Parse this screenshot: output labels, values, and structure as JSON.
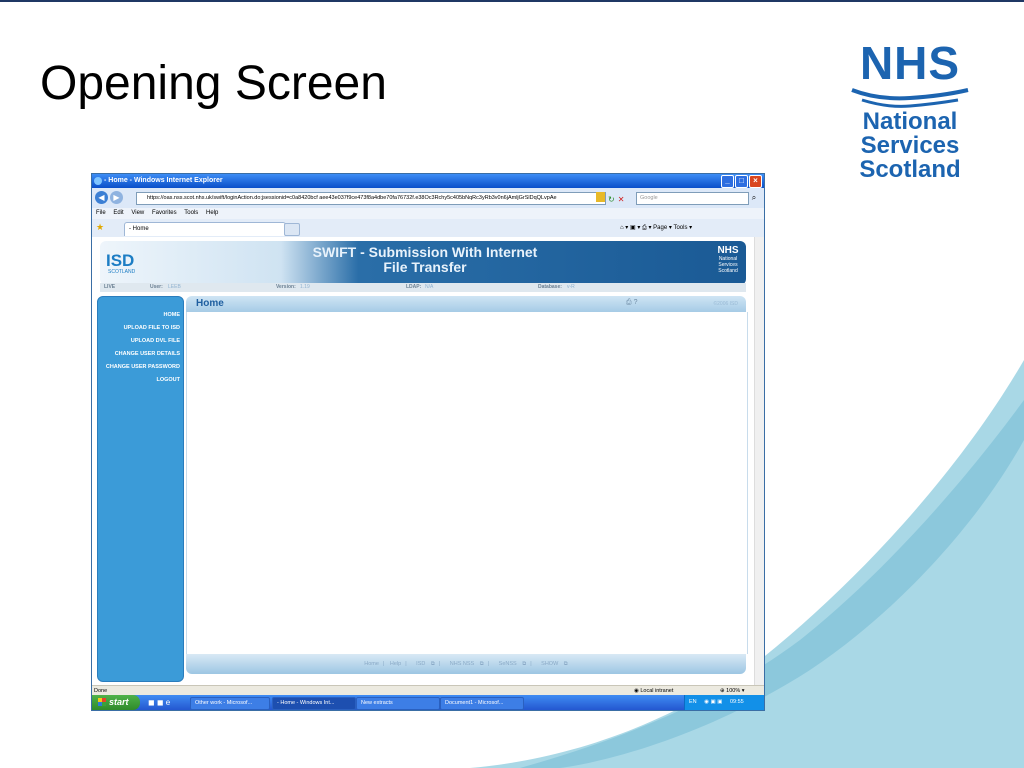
{
  "slide": {
    "title": "Opening Screen",
    "logo": {
      "primary": "NHS",
      "line1": "National",
      "line2": "Services",
      "line3": "Scotland"
    }
  },
  "browser": {
    "window_title": "- Home - Windows Internet Explorer",
    "url": "https://oas.nss.scot.nhs.uk/swift/loginAction.do;jsessionid=c0a8420bcf aee43e037f9ce473f8a4dbe70fa76732f.e38Oc3Rchy5c405bNqRc3yRb3v0n6jAmljGrSlDqQLvpAe",
    "search_placeholder": "Google",
    "menu": [
      "File",
      "Edit",
      "View",
      "Favorites",
      "Tools",
      "Help"
    ],
    "tab_title": "- Home",
    "toolbar": {
      "page": "Page",
      "tools": "Tools"
    },
    "status_text": "Done",
    "zone": "Local intranet",
    "zoom": "100%"
  },
  "swift": {
    "title_line1": "SWIFT - Submission With Internet",
    "title_line2": "File Transfer",
    "isd_logo": "ISD",
    "isd_sub": "SCOTLAND",
    "nhs_logo": "NHS",
    "nhs_sub1": "National",
    "nhs_sub2": "Services",
    "nhs_sub3": "Scotland",
    "info": {
      "live": "LIVE",
      "user_label": "User:",
      "user_value": "LEEB",
      "version_label": "Version:",
      "version_value": "1.19",
      "ldap_label": "LDAP:",
      "ldap_value": "N/A",
      "database_label": "Database:",
      "database_value": "v-R"
    },
    "sidebar": [
      "HOME",
      "UPLOAD FILE TO ISD",
      "UPLOAD DVL FILE",
      "CHANGE USER DETAILS",
      "CHANGE USER PASSWORD",
      "LOGOUT"
    ],
    "panel_title": "Home",
    "copyright": "©2006 ISD",
    "footer": [
      "Home",
      "Help",
      "ISD",
      "NHS NSS",
      "SeNSS",
      "SHOW"
    ]
  },
  "taskbar": {
    "start": "start",
    "tasks": [
      "Other work - Microsof...",
      "- Home - Windows Int...",
      "New extracts",
      "Document1 - Microsof..."
    ],
    "lang": "EN",
    "clock": "09:55"
  },
  "colors": {
    "accent": "#1c64b0",
    "wave": "#a9d8e6",
    "sidebar": "#3b9bd8"
  }
}
